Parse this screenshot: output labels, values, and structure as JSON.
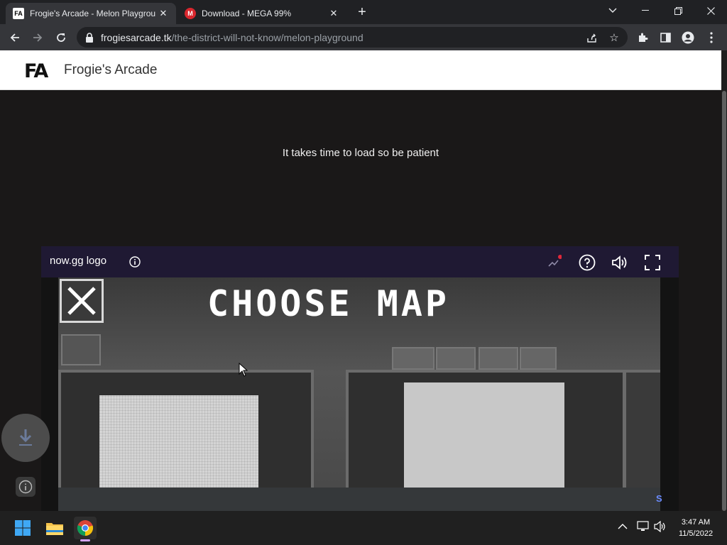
{
  "browser": {
    "tabs": [
      {
        "title": "Frogie's Arcade - Melon Playgrou",
        "favicon": "FA",
        "active": true
      },
      {
        "title": "Download - MEGA 99%",
        "favicon": "M",
        "active": false
      }
    ],
    "url_host": "frogiesarcade.tk",
    "url_path": "/the-district-will-not-know/melon-playground"
  },
  "site": {
    "logo_text": "FA",
    "title": "Frogie's Arcade",
    "load_message": "It takes time to load so be patient"
  },
  "game": {
    "logo_alt": "now.gg logo",
    "heading": "CHOOSE MAP",
    "corner_letter": "S"
  },
  "taskbar": {
    "time": "3:47 AM",
    "date": "11/5/2022"
  },
  "colors": {
    "page_bg": "#1a1818",
    "game_bar": "#1f1933",
    "mega_red": "#d9272e"
  }
}
